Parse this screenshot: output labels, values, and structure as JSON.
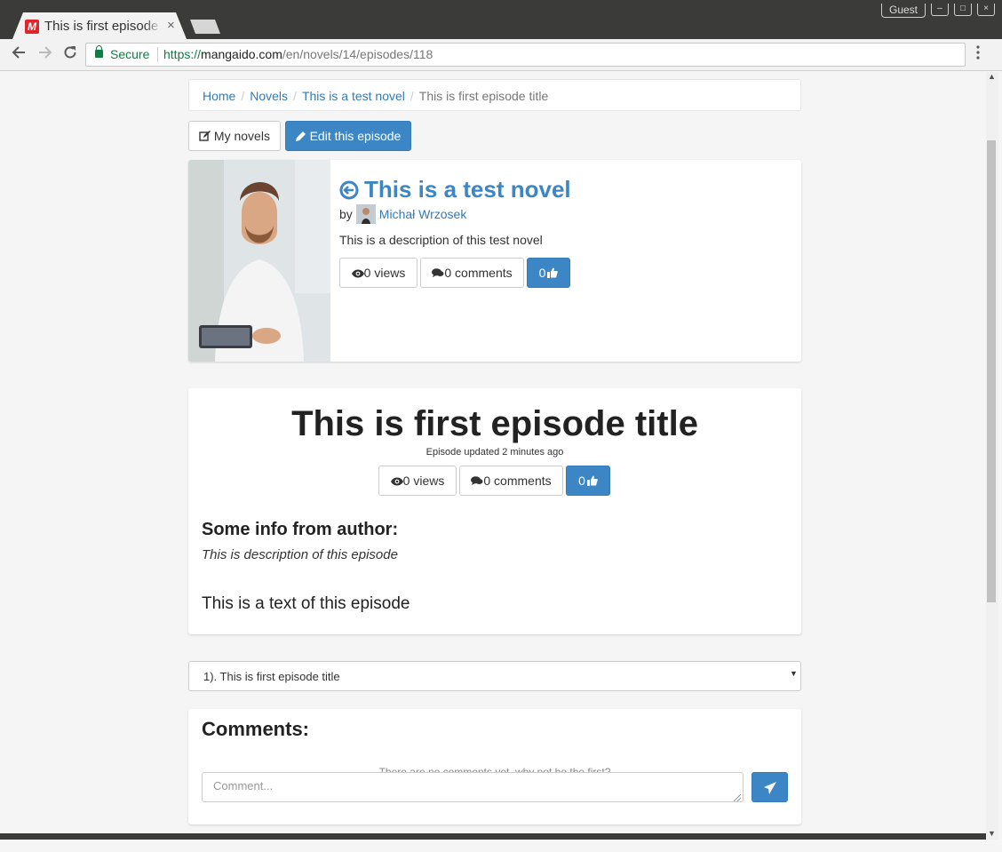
{
  "browser": {
    "tab_title": "This is first episode title",
    "tab_close": "×",
    "favicon_letter": "M",
    "profile_label": "Guest",
    "secure_label": "Secure",
    "url_scheme": "https://",
    "url_host": "mangaido.com",
    "url_path": "/en/novels/14/episodes/118",
    "minimize": "–",
    "maximize": "□",
    "close": "×",
    "icons": [
      "back-arrow-icon",
      "forward-arrow-icon",
      "reload-icon",
      "lock-icon",
      "menu-dots-icon"
    ]
  },
  "breadcrumb": {
    "home": "Home",
    "novels": "Novels",
    "novel": "This is a test novel",
    "current": "This is first episode title",
    "separator": "/"
  },
  "actions": {
    "my_novels": "My novels",
    "edit_episode": "Edit this episode"
  },
  "novel": {
    "title": "This is a test novel",
    "by": "by",
    "author": "Michał Wrzosek",
    "description": "This is a description of this test novel",
    "views": "0 views",
    "comments": "0 comments",
    "likes": "0"
  },
  "episode": {
    "title": "This is first episode title",
    "updated": "Episode updated 2 minutes ago",
    "views": "0 views",
    "comments": "0 comments",
    "likes": "0",
    "info_heading": "Some info from author:",
    "info_description": "This is description of this episode",
    "text": "This is a text of this episode"
  },
  "episode_select": {
    "selected": "1). This is first episode title"
  },
  "comments": {
    "heading": "Comments:",
    "empty_message": "There are no comments yet, why not be the first?",
    "placeholder": "Comment..."
  },
  "colors": {
    "primary": "#3d86c6",
    "link": "#337ab7",
    "secure_green": "#0b8043"
  }
}
